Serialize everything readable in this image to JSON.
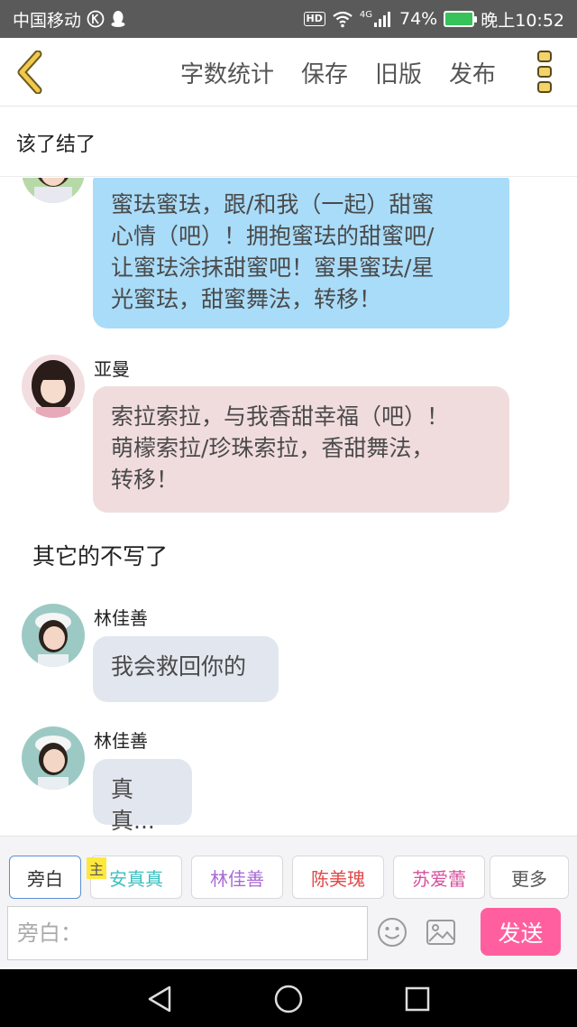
{
  "status_bar": {
    "carrier": "中国移动",
    "hd": "HD",
    "network": "4G",
    "battery": "74%",
    "time": "晚上10:52"
  },
  "toolbar": {
    "actions": [
      "字数统计",
      "保存",
      "旧版",
      "发布"
    ]
  },
  "title": "该了结了",
  "messages": [
    {
      "speaker": "",
      "text_lines": [
        "蜜珐蜜珐，跟/和我（一起）甜蜜",
        "心情（吧）！拥抱蜜珐的甜蜜吧/",
        "让蜜珐涂抹甜蜜吧！蜜果蜜珐/星",
        "光蜜珐，甜蜜舞法，转移！"
      ]
    },
    {
      "speaker": "亚曼",
      "text_lines": [
        "索拉索拉，与我香甜幸福（吧）！",
        "萌檬索拉/珍珠索拉，香甜舞法，",
        "转移！"
      ]
    },
    {
      "narration": "其它的不写了"
    },
    {
      "speaker": "林佳善",
      "text": "我会救回你的"
    },
    {
      "speaker": "林佳善",
      "text": "真真..."
    }
  ],
  "roles": [
    {
      "label": "旁白",
      "color": "#555555"
    },
    {
      "label": "安真真",
      "color": "#3bbfbf"
    },
    {
      "label": "林佳善",
      "color": "#a86bd6"
    },
    {
      "label": "陈美瑰",
      "color": "#e04848"
    },
    {
      "label": "苏爱蕾",
      "color": "#d6509c"
    },
    {
      "label": "更多",
      "color": "#555555"
    }
  ],
  "main_tag": "主",
  "input": {
    "placeholder": "旁白："
  },
  "send_label": "发送",
  "colors": {
    "bubble_blue": "#a9dcf9",
    "bubble_pink": "#f1dcdd",
    "bubble_gray": "#e2e7ef",
    "send_button": "#ff5f9f",
    "back_arrow": "#f2c94c"
  }
}
